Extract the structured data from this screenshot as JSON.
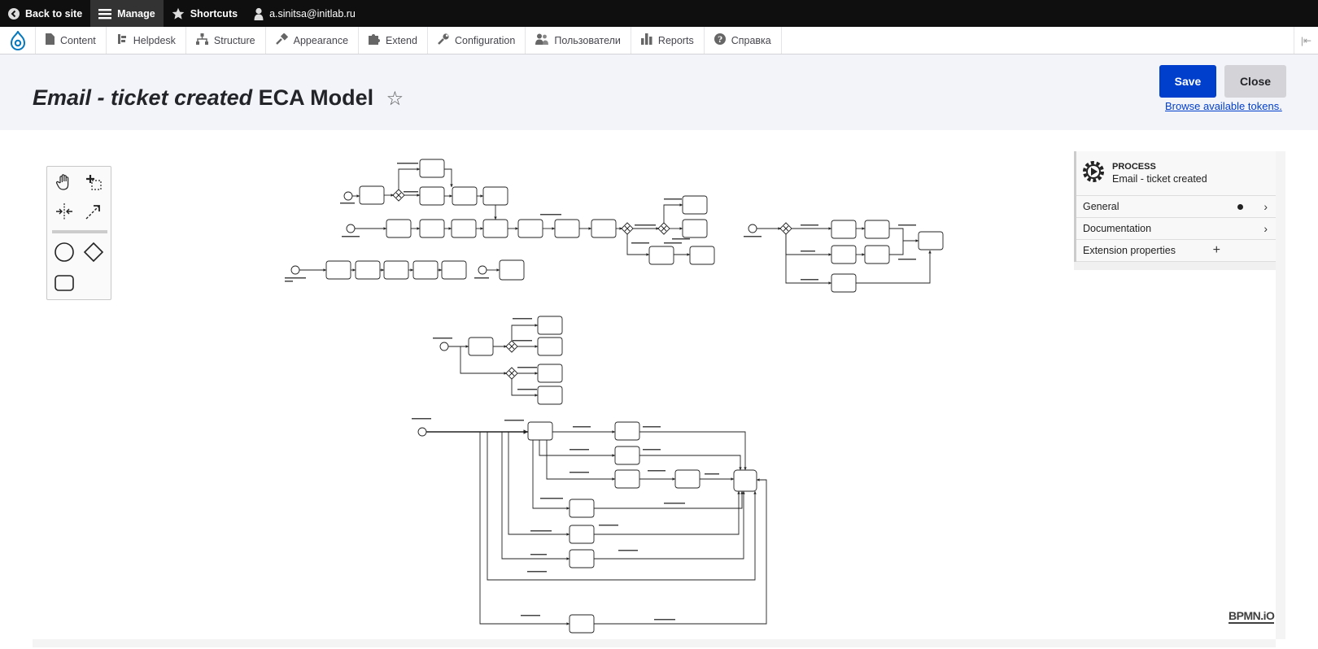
{
  "toolbar": {
    "back_label": "Back to site",
    "manage_label": "Manage",
    "shortcuts_label": "Shortcuts",
    "user_label": "a.sinitsa@initlab.ru"
  },
  "menu": {
    "items": [
      {
        "label": "Content",
        "icon": "file-icon"
      },
      {
        "label": "Helpdesk",
        "icon": "helpdesk-icon"
      },
      {
        "label": "Structure",
        "icon": "sitemap-icon"
      },
      {
        "label": "Appearance",
        "icon": "paint-icon"
      },
      {
        "label": "Extend",
        "icon": "puzzle-icon"
      },
      {
        "label": "Configuration",
        "icon": "wrench-icon"
      },
      {
        "label": "Пользователи",
        "icon": "people-icon"
      },
      {
        "label": "Reports",
        "icon": "chart-icon"
      },
      {
        "label": "Справка",
        "icon": "help-icon"
      }
    ]
  },
  "page": {
    "title_italic": "Email - ticket created",
    "title_rest": "ECA Model",
    "star": "☆",
    "save_label": "Save",
    "close_label": "Close",
    "tokens_link": "Browse available tokens."
  },
  "panel": {
    "type_label": "PROCESS",
    "name": "Email - ticket created",
    "groups": [
      "General",
      "Documentation",
      "Extension properties"
    ]
  },
  "watermark": "BPMN.iO",
  "colors": {
    "accent": "#003ecc",
    "toolbar_bg": "#0f0f0f",
    "header_bg": "#f3f4f9"
  }
}
